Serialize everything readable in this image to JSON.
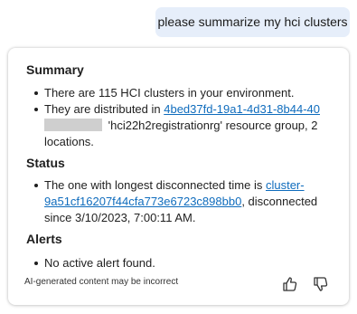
{
  "user_message": "please summarize my hci clusters",
  "response": {
    "summary": {
      "heading": "Summary",
      "item1": "There are 115 HCI clusters in your environment.",
      "item2_prefix": "They are distributed in ",
      "item2_link": "4bed37fd-19a1-4d31-8b44-40",
      "item2_suffix": " 'hci22h2registrationrg' resource group, 2 locations."
    },
    "status": {
      "heading": "Status",
      "prefix": "The one with longest disconnected time is ",
      "link": "cluster-9a51cf16207f44cfa773e6723c898bb0",
      "suffix": ", disconnected since 3/10/2023, 7:00:11 AM."
    },
    "alerts": {
      "heading": "Alerts",
      "item": "No active alert found."
    },
    "disclaimer": "AI-generated content may be incorrect"
  },
  "icons": {
    "like": "thumbs-up-icon",
    "dislike": "thumbs-down-icon"
  },
  "colors": {
    "link": "#0f6cbd",
    "user_bubble": "#e6eefa"
  }
}
